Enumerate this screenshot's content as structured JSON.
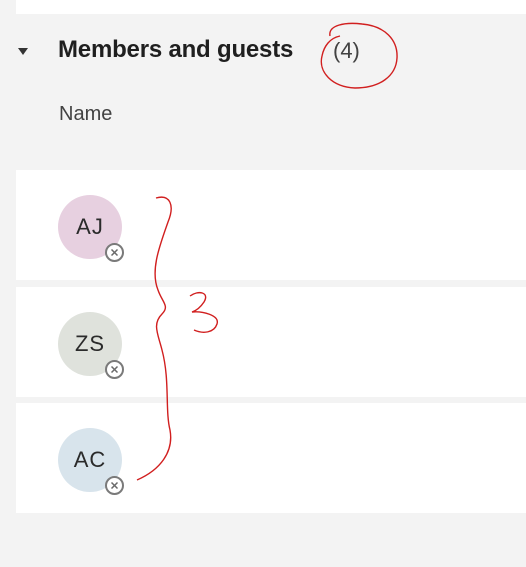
{
  "section": {
    "title": "Members and guests",
    "count": "(4)"
  },
  "table": {
    "column_name": "Name"
  },
  "members": [
    {
      "initials": "AJ",
      "avatar_color": "#e7d0e0"
    },
    {
      "initials": "ZS",
      "avatar_color": "#dfe2dc"
    },
    {
      "initials": "AC",
      "avatar_color": "#d8e4ec"
    }
  ],
  "annotation": {
    "handwritten_number": "3",
    "ink_color": "#d11f1f"
  },
  "icons": {
    "toggle": "caret-down-icon",
    "status": "offline-status-icon"
  }
}
